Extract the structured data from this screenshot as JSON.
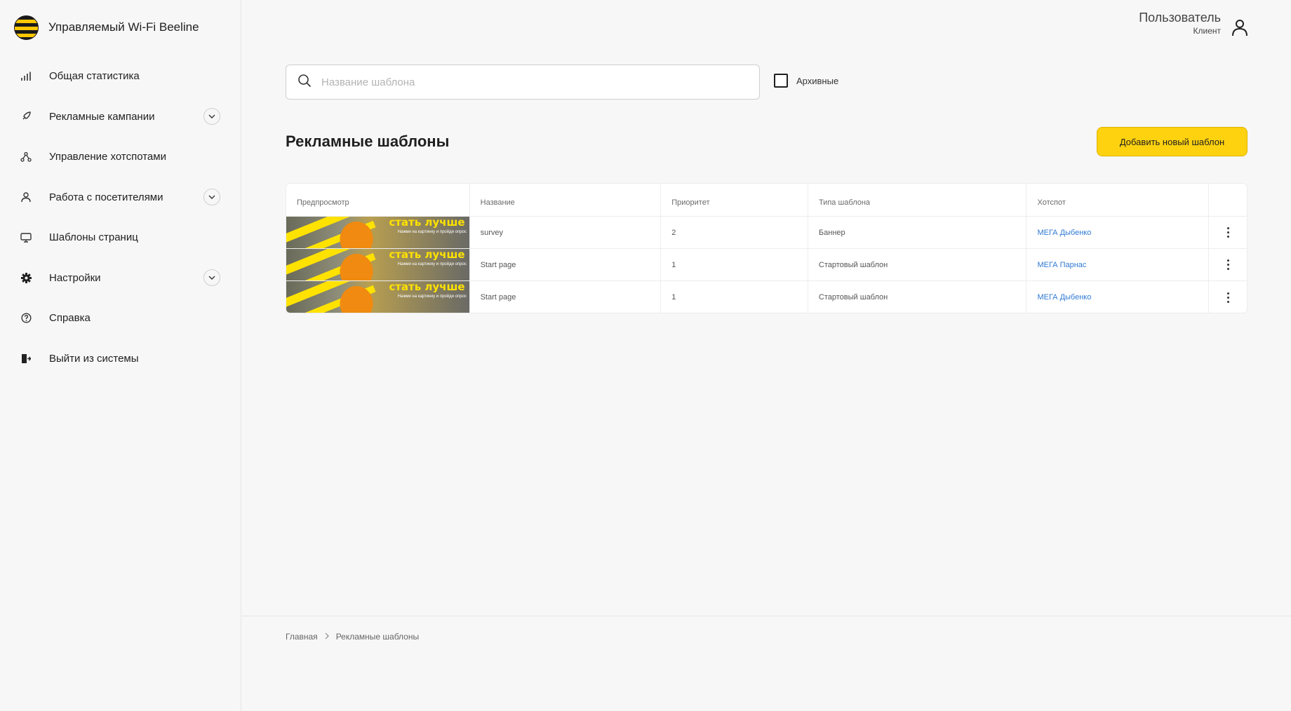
{
  "app": {
    "title": "Управляемый Wi-Fi Beeline"
  },
  "user": {
    "name": "Пользователь",
    "role": "Клиент"
  },
  "sidebar": {
    "items": [
      {
        "label": "Общая статистика",
        "icon": "bar-chart-icon",
        "expandable": false
      },
      {
        "label": "Рекламные кампании",
        "icon": "rocket-icon",
        "expandable": true
      },
      {
        "label": "Управление хотспотами",
        "icon": "network-icon",
        "expandable": false
      },
      {
        "label": "Работа с посетителями",
        "icon": "person-icon",
        "expandable": true
      },
      {
        "label": "Шаблоны страниц",
        "icon": "monitor-icon",
        "expandable": false
      },
      {
        "label": "Настройки",
        "icon": "gear-icon",
        "expandable": true
      },
      {
        "label": "Справка",
        "icon": "help-icon",
        "expandable": false
      },
      {
        "label": "Выйти из системы",
        "icon": "logout-icon",
        "expandable": false
      }
    ]
  },
  "search": {
    "placeholder": "Название шаблона",
    "value": ""
  },
  "archive": {
    "label": "Архивные",
    "checked": false
  },
  "main": {
    "title": "Рекламные шаблоны",
    "add_button": "Добавить новый шаблон"
  },
  "table": {
    "columns": [
      "Предпросмотр",
      "Название",
      "Приоритет",
      "Типа шаблона",
      "Хотспот"
    ],
    "preview": {
      "headline": "стать лучше",
      "caption": "Нажми на картинку и пройди опрос"
    },
    "rows": [
      {
        "name": "survey",
        "priority": "2",
        "type": "Баннер",
        "hotspot": "МЕГА Дыбенко"
      },
      {
        "name": "Start page",
        "priority": "1",
        "type": "Стартовый шаблон",
        "hotspot": "МЕГА Парнас"
      },
      {
        "name": "Start page",
        "priority": "1",
        "type": "Стартовый шаблон",
        "hotspot": "МЕГА Дыбенко"
      }
    ]
  },
  "breadcrumb": {
    "home": "Главная",
    "current": "Рекламные шаблоны"
  },
  "colors": {
    "accent": "#ffd20f",
    "link": "#2f7ad4",
    "background": "#f7f7f7"
  }
}
